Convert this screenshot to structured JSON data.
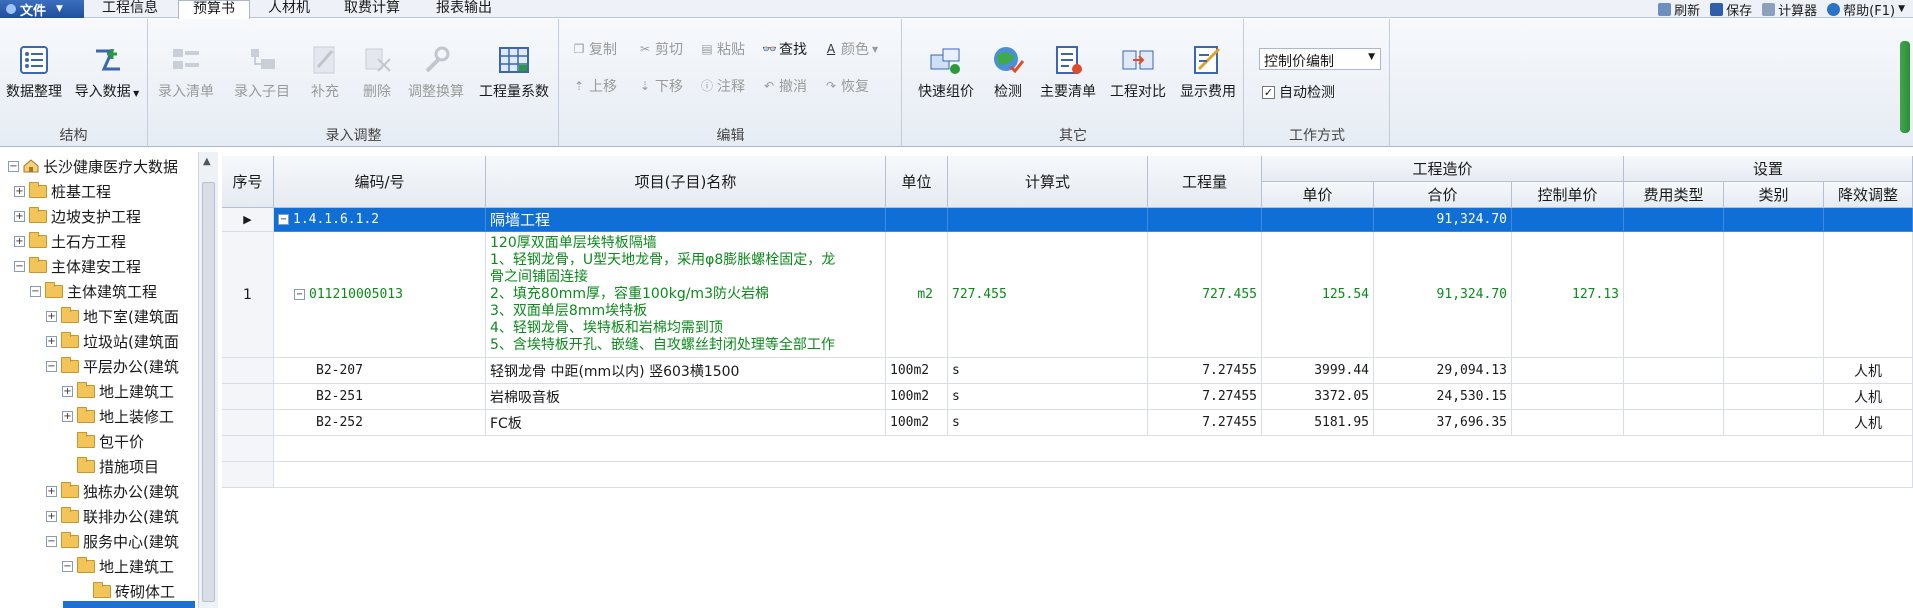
{
  "menubar": {
    "file_label": "文件",
    "tabs": [
      "工程信息",
      "预算书",
      "人材机",
      "取费计算",
      "报表输出"
    ],
    "active_tab": "预算书",
    "right_items": [
      "刷新",
      "保存",
      "计算器",
      "帮助(F1)"
    ]
  },
  "ribbon": {
    "groups": {
      "structure": {
        "label": "结构",
        "buttons": [
          "数据整理",
          "导入数据"
        ]
      },
      "entry": {
        "label": "录入调整",
        "buttons": [
          "录入清单",
          "录入子目",
          "补充",
          "删除",
          "调整换算",
          "工程量系数"
        ]
      },
      "edit": {
        "label": "编辑",
        "row1": [
          "复制",
          "剪切",
          "粘贴",
          "查找",
          "颜色"
        ],
        "row2": [
          "上移",
          "下移",
          "注释",
          "撤消",
          "恢复"
        ]
      },
      "other": {
        "label": "其它",
        "buttons": [
          "快速组价",
          "检测",
          "主要清单",
          "工程对比",
          "显示费用"
        ]
      },
      "mode": {
        "label": "工作方式",
        "select_value": "控制价编制",
        "checkbox_label": "自动检测",
        "checkbox_checked": true
      }
    }
  },
  "tree": {
    "items": [
      {
        "label": "长沙健康医疗大数据",
        "level": 0,
        "exp": "-"
      },
      {
        "label": "桩基工程",
        "level": 1,
        "exp": "+"
      },
      {
        "label": "边坡支护工程",
        "level": 1,
        "exp": "+"
      },
      {
        "label": "土石方工程",
        "level": 1,
        "exp": "+"
      },
      {
        "label": "主体建安工程",
        "level": 1,
        "exp": "-"
      },
      {
        "label": "主体建筑工程",
        "level": 2,
        "exp": "-"
      },
      {
        "label": "地下室(建筑面",
        "level": 3,
        "exp": "+"
      },
      {
        "label": "垃圾站(建筑面",
        "level": 3,
        "exp": "+"
      },
      {
        "label": "平层办公(建筑",
        "level": 3,
        "exp": "-"
      },
      {
        "label": "地上建筑工",
        "level": 4,
        "exp": "+"
      },
      {
        "label": "地上装修工",
        "level": 4,
        "exp": "+"
      },
      {
        "label": "包干价",
        "level": 4,
        "exp": ""
      },
      {
        "label": "措施项目",
        "level": 4,
        "exp": ""
      },
      {
        "label": "独栋办公(建筑",
        "level": 3,
        "exp": "+"
      },
      {
        "label": "联排办公(建筑",
        "level": 3,
        "exp": "+"
      },
      {
        "label": "服务中心(建筑",
        "level": 3,
        "exp": "-"
      },
      {
        "label": "地上建筑工",
        "level": 4,
        "exp": "-"
      },
      {
        "label": "砖砌体工",
        "level": 5,
        "exp": ""
      }
    ]
  },
  "grid": {
    "headers": {
      "seq": "序号",
      "code": "编码/号",
      "name": "项目(子目)名称",
      "unit": "单位",
      "formula": "计算式",
      "qty": "工程量",
      "cost_group": "工程造价",
      "unit_price": "单价",
      "total": "合价",
      "ctrl_price": "控制单价",
      "settings_group": "设置",
      "fee_type": "费用类型",
      "category": "类别",
      "reduce": "降效调整"
    },
    "rows": [
      {
        "seq": "",
        "code": "1.4.1.6.1.2",
        "name": "隔墙工程",
        "unit": "",
        "formula": "",
        "qty": "",
        "unit_price": "",
        "total": "91,324.70",
        "ctrl_price": "",
        "fee_type": "",
        "category": "",
        "reduce": ""
      },
      {
        "seq": "1",
        "code": "011210005013",
        "desc": [
          "120厚双面单层埃特板隔墙",
          "1、轻钢龙骨，U型天地龙骨，采用φ8膨胀螺栓固定，龙",
          "骨之间铺固连接",
          "2、填充80mm厚，容重100kg/m3防火岩棉",
          "3、双面单层8mm埃特板",
          "4、轻钢龙骨、埃特板和岩棉均需到顶",
          "5、含埃特板开孔、嵌缝、自攻螺丝封闭处理等全部工作"
        ],
        "unit": "m2",
        "formula": "727.455",
        "qty": "727.455",
        "unit_price": "125.54",
        "total": "91,324.70",
        "ctrl_price": "127.13",
        "fee_type": "",
        "category": "",
        "reduce": ""
      },
      {
        "seq": "",
        "code": "B2-207",
        "name": "轻钢龙骨  中距(mm以内) 竖603横1500",
        "unit": "100m2",
        "formula": "s",
        "qty": "7.27455",
        "unit_price": "3999.44",
        "total": "29,094.13",
        "ctrl_price": "",
        "fee_type": "",
        "category": "",
        "reduce": "人机"
      },
      {
        "seq": "",
        "code": "B2-251",
        "name": "岩棉吸音板",
        "unit": "100m2",
        "formula": "s",
        "qty": "7.27455",
        "unit_price": "3372.05",
        "total": "24,530.15",
        "ctrl_price": "",
        "fee_type": "",
        "category": "",
        "reduce": "人机"
      },
      {
        "seq": "",
        "code": "B2-252",
        "name": "FC板",
        "unit": "100m2",
        "formula": "s",
        "qty": "7.27455",
        "unit_price": "5181.95",
        "total": "37,696.35",
        "ctrl_price": "",
        "fee_type": "",
        "category": "",
        "reduce": "人机"
      }
    ]
  }
}
